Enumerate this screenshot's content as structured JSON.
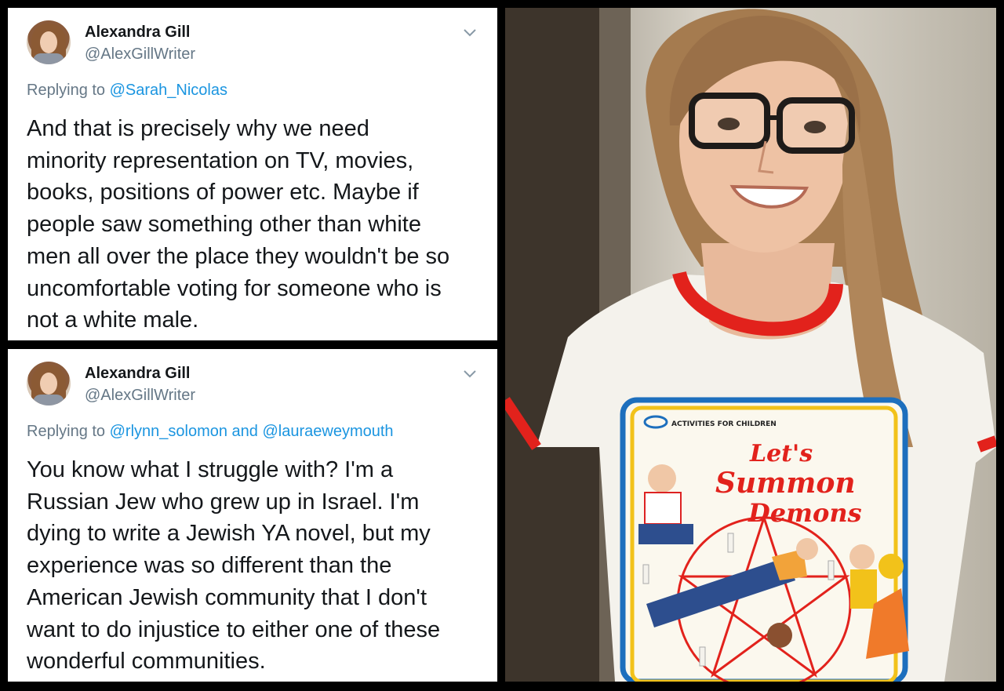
{
  "tweets": [
    {
      "name": "Alexandra Gill",
      "handle": "@AlexGillWriter",
      "replying_prefix": "Replying to ",
      "mentions": [
        "@Sarah_Nicolas"
      ],
      "body_lines": [
        "And that is precisely why we need",
        "minority representation on TV, movies,",
        "books, positions of power etc. Maybe if",
        "people saw something other than white",
        "men all over the place they wouldn't be so",
        "uncomfortable voting for someone who is",
        "not a white male."
      ]
    },
    {
      "name": "Alexandra Gill",
      "handle": "@AlexGillWriter",
      "replying_prefix": "Replying to ",
      "mentions": [
        "@rlynn_solomon",
        "@lauraeweymouth"
      ],
      "mention_joiner": " and ",
      "body_lines": [
        "You know what I struggle with? I'm a",
        "Russian Jew who grew up in Israel. I'm",
        "dying to write a Jewish YA novel, but my",
        "experience was so different than the",
        "American Jewish community that I don't",
        "want to do injustice to either one of these",
        "wonderful communities."
      ]
    }
  ],
  "photo": {
    "shirt_text_small": "ACTIVITIES FOR CHILDREN",
    "shirt_title_1": "Let's",
    "shirt_title_2": "Summon",
    "shirt_title_3": "Demons"
  },
  "colors": {
    "mention": "#1b95e0",
    "secondary_text": "#657786",
    "primary_text": "#14171a",
    "shirt_red": "#e2221c"
  },
  "icons": {
    "caret": "chevron-down-icon"
  }
}
